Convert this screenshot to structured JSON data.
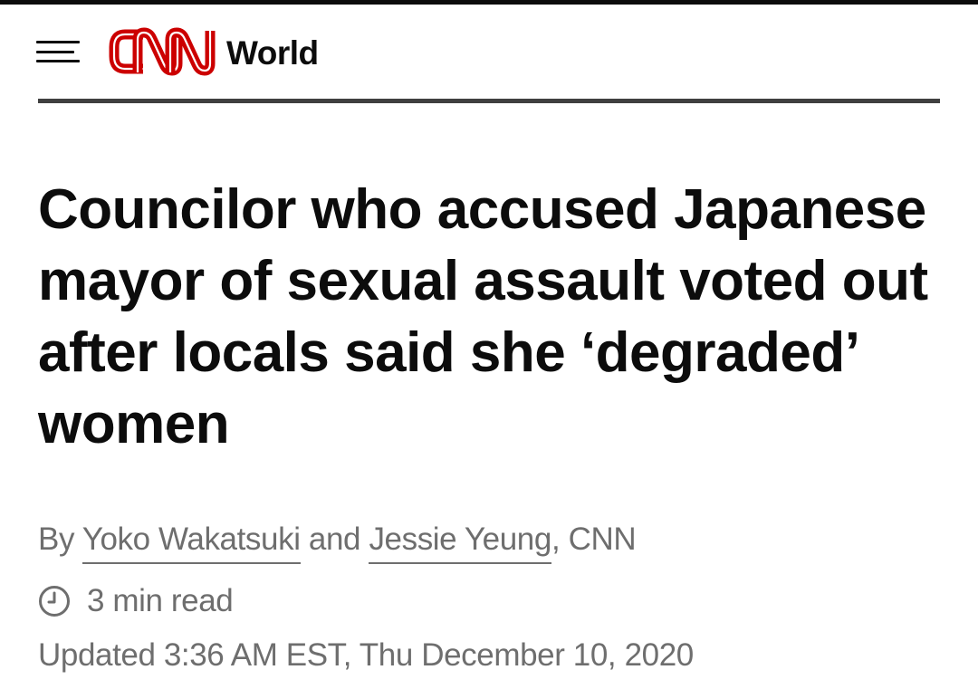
{
  "header": {
    "logo_text": "CNN",
    "section": "World",
    "brand_color": "#cc0000"
  },
  "article": {
    "headline": "Councilor who accused Japanese mayor of sexual assault voted out after locals said she ‘degraded’ women",
    "byline": {
      "prefix": "By",
      "author1": "Yoko Wakatsuki",
      "conjunction": "and",
      "author2": "Jessie Yeung",
      "suffix": ", CNN"
    },
    "read_time": "3 min read",
    "updated": "Updated 3:36 AM EST, Thu December 10, 2020"
  },
  "icons": {
    "menu": "hamburger-menu-icon",
    "clock": "clock-icon"
  }
}
